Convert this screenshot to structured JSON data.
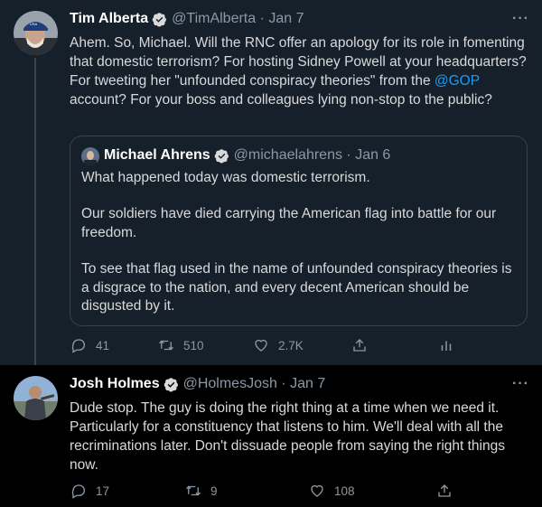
{
  "tweet1": {
    "name": "Tim Alberta",
    "handle": "@TimAlberta",
    "date": "Jan 7",
    "text_before_link": "Ahem. So, Michael. Will the RNC offer an apology for its role in fomenting that domestic terrorism? For hosting Sidney Powell at your headquarters? For tweeting her \"unfounded conspiracy theories\" from the ",
    "link": "@GOP",
    "text_after_link": " account? For your boss and colleagues lying non-stop to the public?",
    "replies": "41",
    "retweets": "510",
    "likes": "2.7K"
  },
  "quoted": {
    "name": "Michael Ahrens",
    "handle": "@michaelahrens",
    "date": "Jan 6",
    "p1": "What happened today was domestic terrorism.",
    "p2": "Our soldiers have died carrying the American flag into battle for our freedom.",
    "p3": "To see that flag used in the name of unfounded conspiracy theories is a disgrace to the nation, and every decent American should be disgusted by it."
  },
  "tweet2": {
    "name": "Josh Holmes",
    "handle": "@HolmesJosh",
    "date": "Jan 7",
    "text": "Dude stop. The guy is doing the right thing at a time when we need it. Particularly for a constituency that listens to him. We'll deal with all the recriminations later. Don't dissuade people from saying the right things now.",
    "replies": "17",
    "retweets": "9",
    "likes": "108"
  },
  "icons": {
    "reply": "reply-icon",
    "retweet": "retweet-icon",
    "like": "heart-icon",
    "share": "share-icon",
    "analytics": "analytics-icon",
    "more": "more-icon",
    "verified": "verified-badge-icon"
  },
  "colors": {
    "dim_bg": "#15202b",
    "black_bg": "#000000",
    "link": "#1d9bf0",
    "secondary": "#8b98a5"
  }
}
